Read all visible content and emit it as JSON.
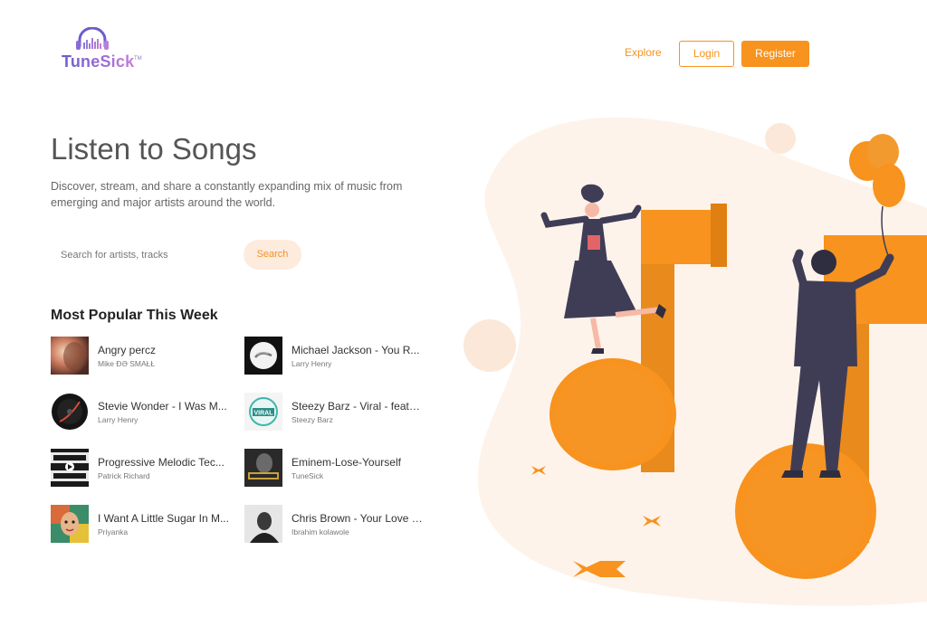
{
  "brand": {
    "name": "TuneSick",
    "tm": "TM"
  },
  "nav": {
    "explore": "Explore",
    "login": "Login",
    "register": "Register"
  },
  "hero": {
    "title": "Listen to Songs",
    "description": "Discover, stream, and share a constantly expanding mix of music from emerging and major artists around the world."
  },
  "search": {
    "placeholder": "Search for artists, tracks",
    "button": "Search"
  },
  "popular": {
    "title": "Most Popular This Week",
    "songs": [
      {
        "title": "Angry percz",
        "artist": "Mike ÐƏ SMAŁŁ",
        "thumb": "warm-blur"
      },
      {
        "title": "Michael Jackson - You R...",
        "artist": "Larry Henry",
        "thumb": "record-logo"
      },
      {
        "title": "Stevie Wonder - I Was M...",
        "artist": "Larry Henry",
        "thumb": "vinyl-dark"
      },
      {
        "title": "Steezy Barz - Viral - feat -...",
        "artist": "Steezy Barz",
        "thumb": "viral-badge"
      },
      {
        "title": "Progressive Melodic Tec...",
        "artist": "Patrick Richard",
        "thumb": "melodic-techno"
      },
      {
        "title": "Eminem-Lose-Yourself",
        "artist": "TuneSick",
        "thumb": "eminem-cover"
      },
      {
        "title": "I Want A Little Sugar In M...",
        "artist": "Priyanka",
        "thumb": "colorful-face"
      },
      {
        "title": "Chris Brown - Your Love [...",
        "artist": "Ibrahim kolawole",
        "thumb": "bw-portrait"
      }
    ]
  },
  "colors": {
    "accent": "#f7931e",
    "accent_light": "#fdebdd",
    "blob": "#fdf3ea"
  }
}
